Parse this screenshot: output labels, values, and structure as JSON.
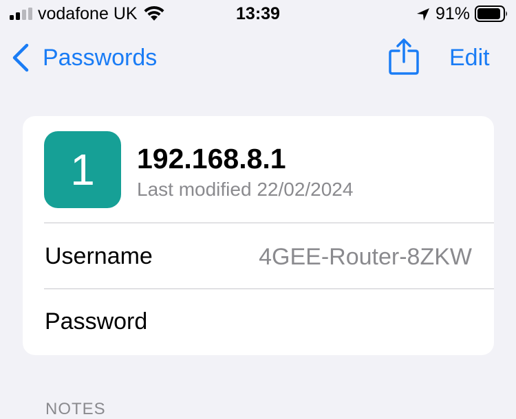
{
  "status_bar": {
    "carrier": "vodafone UK",
    "time": "13:39",
    "battery_percent": "91%",
    "battery_level": 0.91,
    "icons": [
      "signal-icon",
      "wifi-icon",
      "location-arrow-icon",
      "battery-icon"
    ]
  },
  "nav": {
    "back_label": "Passwords",
    "edit_label": "Edit",
    "icons": [
      "chevron-left-icon",
      "share-icon"
    ]
  },
  "entry": {
    "avatar_letter": "1",
    "title": "192.168.8.1",
    "last_modified": "Last modified 22/02/2024",
    "avatar_color": "#16a096"
  },
  "fields": {
    "username_label": "Username",
    "username_value": "4GEE-Router-8ZKW",
    "password_label": "Password"
  },
  "notes": {
    "header": "NOTES"
  },
  "colors": {
    "accent": "#1a7cf5",
    "background": "#f2f2f7",
    "secondary_text": "#8a8a8e"
  }
}
